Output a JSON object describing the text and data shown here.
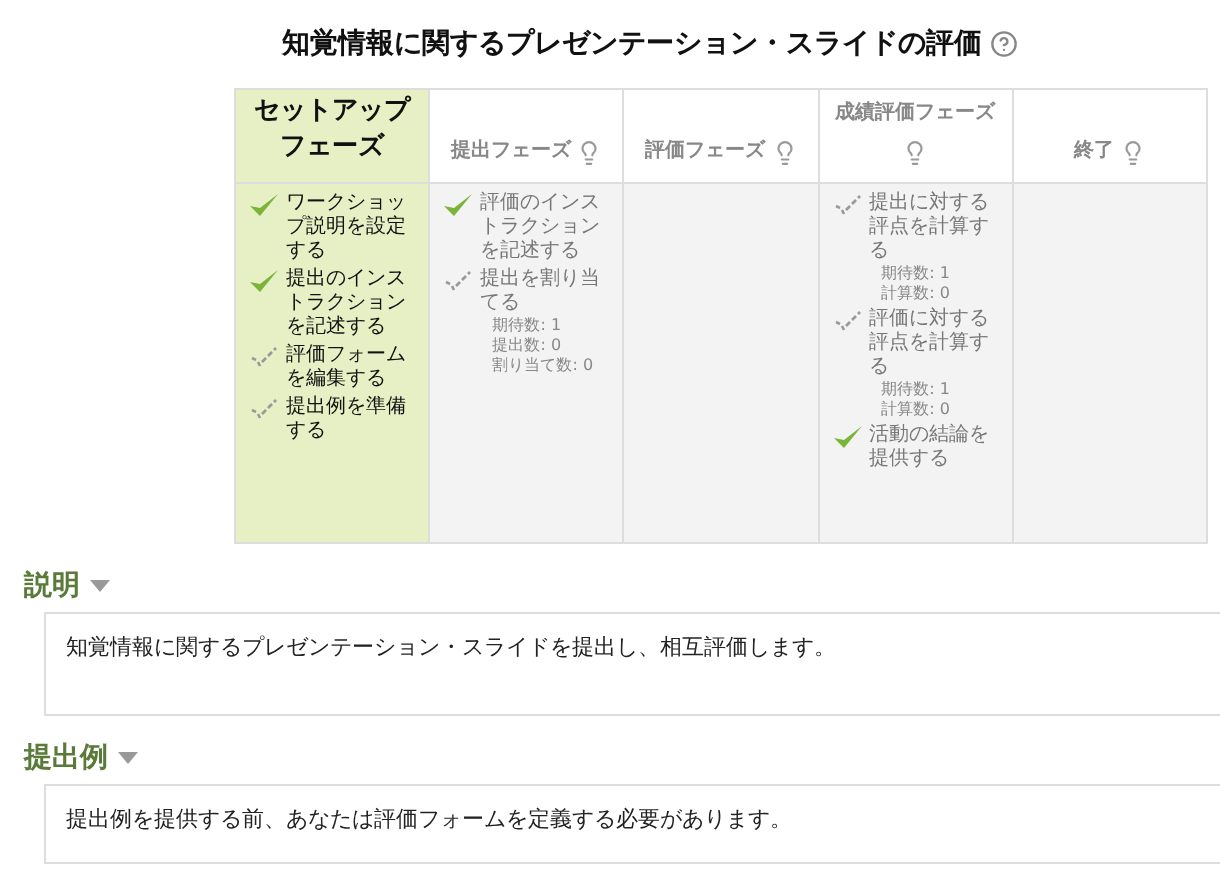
{
  "title": "知覚情報に関するプレゼンテーション・スライドの評価",
  "phases": [
    {
      "name": "セットアップフェーズ",
      "selected": true,
      "has_info": false,
      "tasks": [
        {
          "kind": "done",
          "label": "ワークショップ説明を設定する"
        },
        {
          "kind": "done",
          "label": "提出のインストラクションを記述する"
        },
        {
          "kind": "todo",
          "label": "評価フォームを編集する"
        },
        {
          "kind": "todo",
          "label": "提出例を準備する"
        }
      ]
    },
    {
      "name": "提出フェーズ",
      "selected": false,
      "has_info": true,
      "tasks": [
        {
          "kind": "done",
          "label": "評価のインストラクションを記述する"
        },
        {
          "kind": "todo",
          "label": "提出を割り当てる",
          "details": [
            "期待数: 1",
            "提出数: 0",
            "割り当て数: 0"
          ]
        }
      ]
    },
    {
      "name": "評価フェーズ",
      "selected": false,
      "has_info": true
    },
    {
      "name": "成績評価フェーズ",
      "selected": false,
      "has_info": true,
      "tasks": [
        {
          "kind": "todo",
          "label": "提出に対する評点を計算する",
          "details": [
            "期待数: 1",
            "計算数: 0"
          ]
        },
        {
          "kind": "todo",
          "label": "評価に対する評点を計算する",
          "details": [
            "期待数: 1",
            "計算数: 0"
          ]
        },
        {
          "kind": "done",
          "label": "活動の結論を提供する"
        }
      ]
    },
    {
      "name": "終了",
      "selected": false,
      "has_info": true
    }
  ],
  "sections": [
    {
      "heading": "説明",
      "expanded": true,
      "text": "知覚情報に関するプレゼンテーション・スライドを提出し、相互評価します。"
    },
    {
      "heading": "提出例",
      "expanded": true,
      "text": "提出例を提供する前、あなたは評価フォームを定義する必要があります。"
    }
  ]
}
